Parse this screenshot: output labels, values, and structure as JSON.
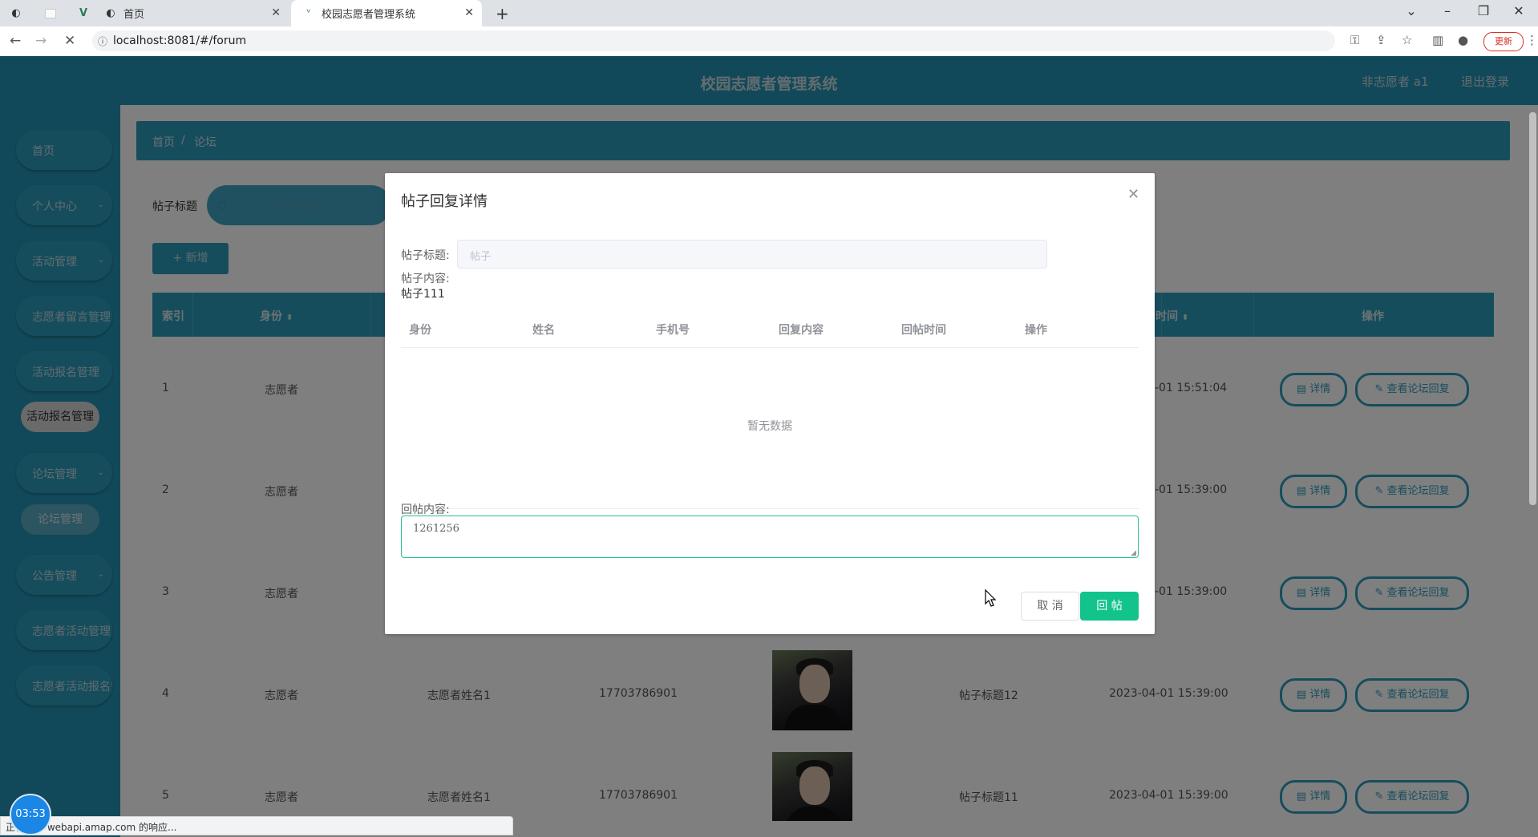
{
  "browser": {
    "tabs": [
      {
        "label": ""
      },
      {
        "label": ""
      },
      {
        "label": ""
      },
      {
        "label": "首页"
      },
      {
        "label": "校园志愿者管理系统"
      }
    ],
    "address": "localhost:8081/#/forum",
    "update_label": "更新",
    "status_text": "正在等待 webapi.amap.com 的响应..."
  },
  "header": {
    "title": "校园志愿者管理系统",
    "user": "非志愿者 a1",
    "logout": "退出登录"
  },
  "sidebar": {
    "items": [
      {
        "label": "首页"
      },
      {
        "label": "个人中心"
      },
      {
        "label": "活动管理"
      },
      {
        "label": "志愿者留言管理"
      },
      {
        "label": "活动报名管理"
      },
      {
        "label": "活动报名管理"
      },
      {
        "label": "论坛管理"
      },
      {
        "label": "论坛管理"
      },
      {
        "label": "公告管理"
      },
      {
        "label": "志愿者活动管理"
      },
      {
        "label": "志愿者活动报名管理"
      }
    ]
  },
  "main": {
    "breadcrumb": [
      "首页",
      "/",
      "论坛"
    ],
    "search_label": "帖子标题",
    "search_placeholder": "帖子标题",
    "add_button": "+ 新增",
    "columns": [
      "索引",
      "身份",
      "时间",
      "操作"
    ],
    "rows": [
      {
        "index": "1",
        "identity": "志愿者",
        "name": "",
        "phone": "",
        "title": "",
        "time": "-01 15:51:04"
      },
      {
        "index": "2",
        "identity": "志愿者",
        "name": "",
        "phone": "",
        "title": "",
        "time": "-01 15:39:00"
      },
      {
        "index": "3",
        "identity": "志愿者",
        "name": "",
        "phone": "",
        "title": "",
        "time": "-01 15:39:00"
      },
      {
        "index": "4",
        "identity": "志愿者",
        "name": "志愿者姓名1",
        "phone": "17703786901",
        "title": "帖子标题12",
        "time": "2023-04-01 15:39:00"
      },
      {
        "index": "5",
        "identity": "志愿者",
        "name": "志愿者姓名1",
        "phone": "17703786901",
        "title": "帖子标题11",
        "time": "2023-04-01 15:39:00"
      }
    ],
    "detail_button": "详情",
    "reply_button": "查看论坛回复"
  },
  "dialog": {
    "title": "帖子回复详情",
    "post_title_label": "帖子标题:",
    "post_title_value": "帖子",
    "post_content_label": "帖子内容:",
    "post_content_value": "帖子111",
    "reply_columns": [
      "身份",
      "姓名",
      "手机号",
      "回复内容",
      "回帖时间",
      "操作"
    ],
    "empty_text": "暂无数据",
    "reply_label": "回帖内容:",
    "reply_value": "1261256",
    "cancel": "取 消",
    "submit": "回 帖"
  },
  "clock": "03:53"
}
